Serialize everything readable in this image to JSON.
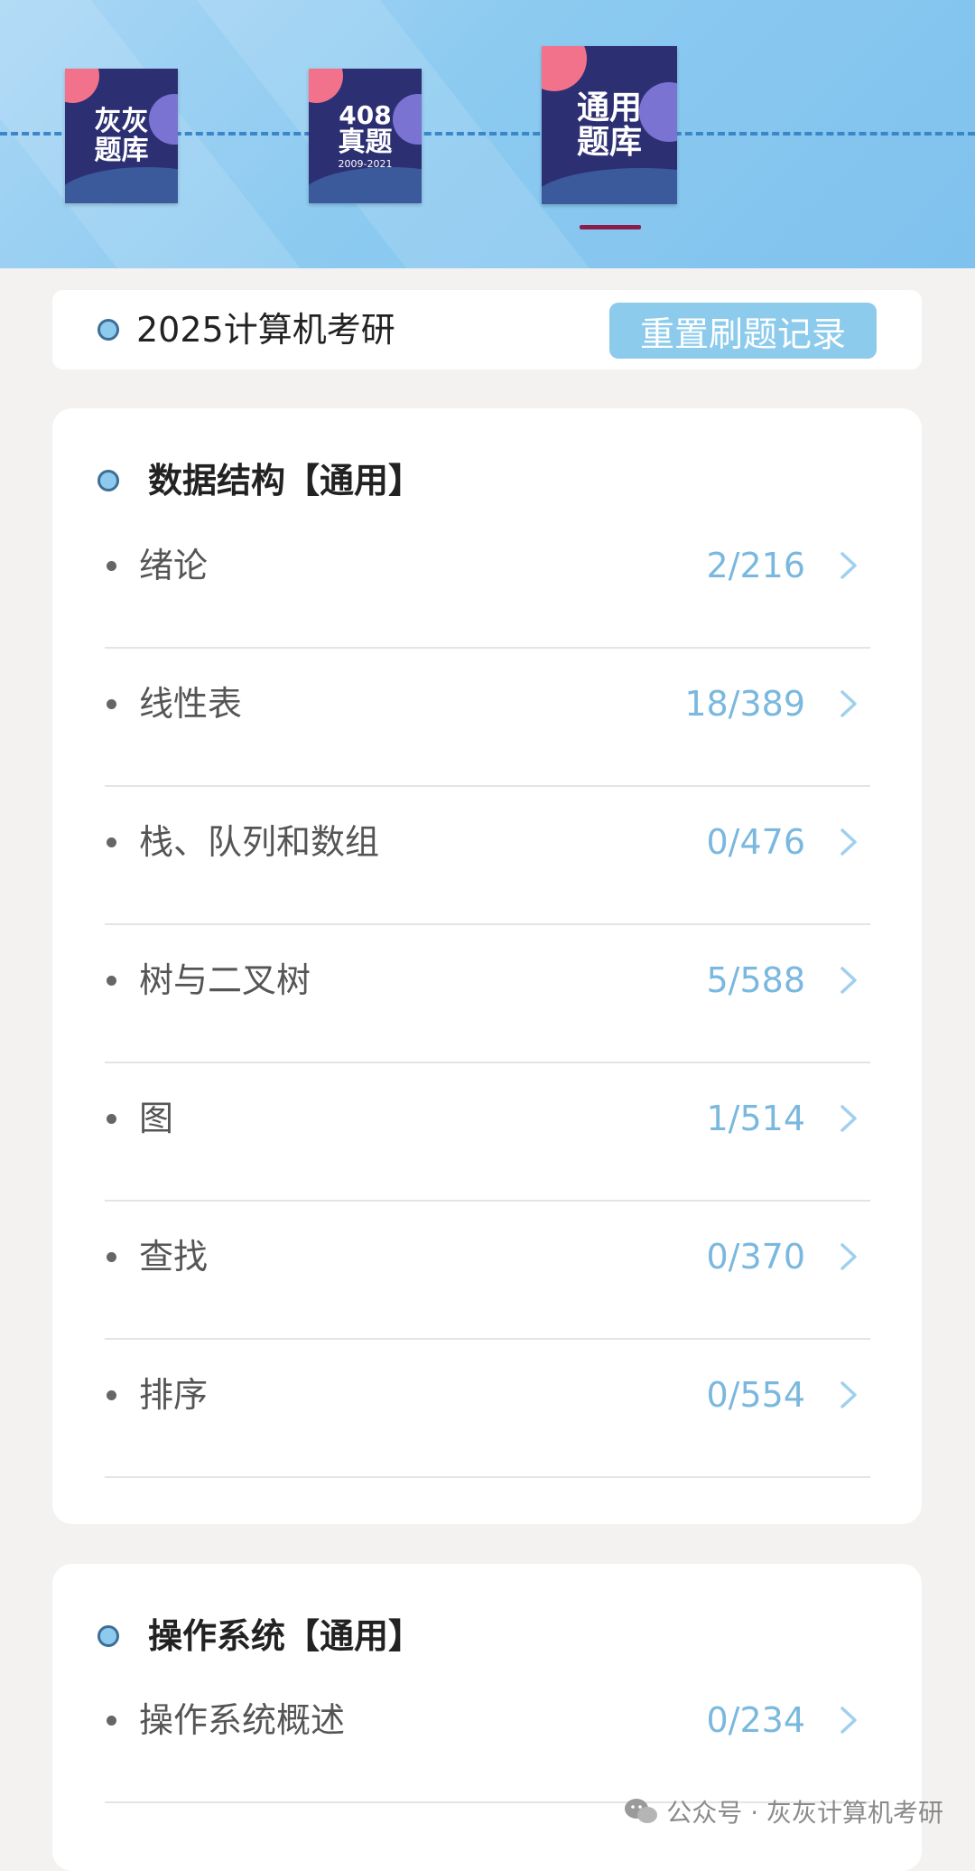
{
  "header": {
    "tiles": [
      {
        "line1": "灰灰",
        "line2": "题库",
        "sub": ""
      },
      {
        "line1": "408",
        "line2": "真题",
        "sub": "2009-2021"
      },
      {
        "line1": "通用",
        "line2": "题库",
        "sub": ""
      }
    ],
    "active_tab_index": 2
  },
  "exam": {
    "title": "2025计算机考研",
    "reset_label": "重置刷题记录"
  },
  "sections": [
    {
      "title": "数据结构【通用】",
      "items": [
        {
          "label": "绪论",
          "count": "2/216"
        },
        {
          "label": "线性表",
          "count": "18/389"
        },
        {
          "label": "栈、队列和数组",
          "count": "0/476"
        },
        {
          "label": "树与二叉树",
          "count": "5/588"
        },
        {
          "label": "图",
          "count": "1/514"
        },
        {
          "label": "查找",
          "count": "0/370"
        },
        {
          "label": "排序",
          "count": "0/554"
        }
      ]
    },
    {
      "title": "操作系统【通用】",
      "items": [
        {
          "label": "操作系统概述",
          "count": "0/234"
        }
      ]
    }
  ],
  "watermark": "公众号 · 灰灰计算机考研",
  "colors": {
    "accent": "#8ccbec",
    "count_text": "#7ab8df",
    "tab_indicator": "#8a1d4a",
    "tile_bg": "#2d2f73"
  },
  "icons": {
    "chevron": "chevron-right-icon",
    "section_dot": "section-dot-icon",
    "watermark": "wechat-icon"
  }
}
